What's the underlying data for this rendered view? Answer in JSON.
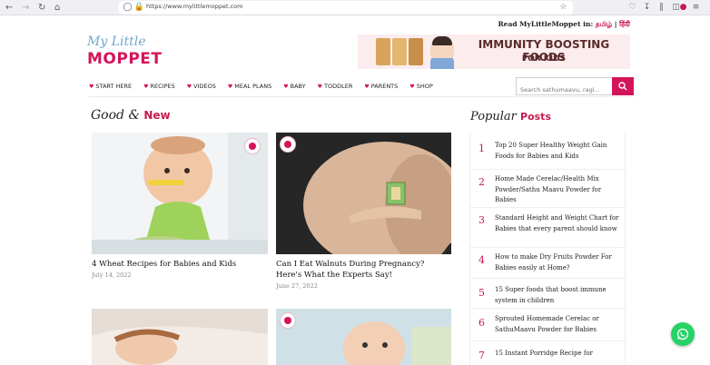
{
  "browser": {
    "url": "https://www.mylittlemoppet.com"
  },
  "header": {
    "read_prefix": "Read MyLittleMoppet in:",
    "lang_tamil": "தமிழ்",
    "separator": "|",
    "lang_hindi": "हिंदी",
    "logo_line1": "My Little",
    "logo_line2": "MOPPET"
  },
  "banner": {
    "line1": "IMMUNITY BOOSTING FOODS",
    "line2": "FOR KIDS"
  },
  "menu": {
    "items": [
      {
        "label": "START HERE"
      },
      {
        "label": "RECIPES"
      },
      {
        "label": "VIDEOS"
      },
      {
        "label": "MEAL PLANS"
      },
      {
        "label": "BABY"
      },
      {
        "label": "TODDLER"
      },
      {
        "label": "PARENTS"
      },
      {
        "label": "SHOP"
      }
    ]
  },
  "search": {
    "placeholder": "Search sathumaavu, ragi..."
  },
  "good_new": {
    "heading_a": "Good &",
    "heading_b": "New",
    "cards": [
      {
        "title": "4 Wheat Recipes for Babies and Kids",
        "date": "July 14, 2022"
      },
      {
        "title": "Can I Eat Walnuts During Pregnancy? Here's What the Experts Say!",
        "date": "June 27, 2022"
      }
    ]
  },
  "popular": {
    "heading_a": "Popular",
    "heading_b": "Posts",
    "items": [
      {
        "num": "1",
        "text": "Top 20 Super Healthy Weight Gain Foods for Babies and Kids"
      },
      {
        "num": "2",
        "text": "Home Made Cerelac/Health Mix Powder/Sathu Maavu Powder for Babies"
      },
      {
        "num": "3",
        "text": "Standard Height and Weight Chart for Babies that every parent should know"
      },
      {
        "num": "4",
        "text": "How to make Dry Fruits Powder For Babies easily at Home?"
      },
      {
        "num": "5",
        "text": "15 Super foods that boost immune system in children"
      },
      {
        "num": "6",
        "text": "Sprouted Homemade Cerelac or SathuMaavu Powder for Babies"
      },
      {
        "num": "7",
        "text": "15 Instant Porridge Recipe for"
      }
    ]
  },
  "colors": {
    "brand": "#d4145a",
    "whatsapp": "#25d366"
  }
}
